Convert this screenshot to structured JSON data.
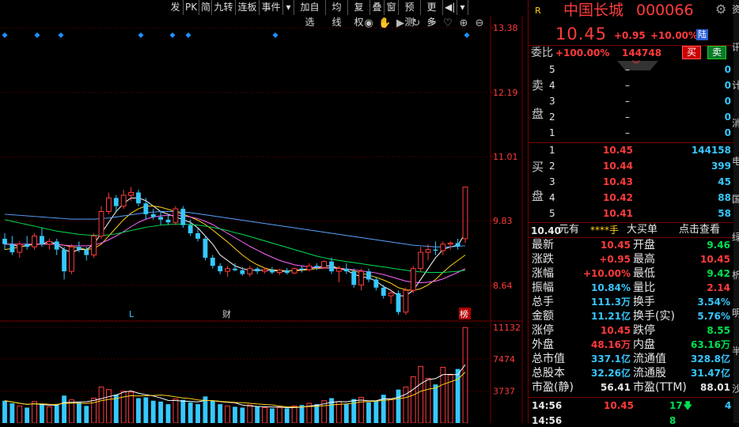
{
  "toolbar": {
    "items": [
      "发",
      "PK",
      "简",
      "九转",
      "连板",
      "事件",
      "▾",
      "加自选",
      "均线",
      "复权",
      "叠",
      "窗",
      "预测",
      "更多",
      "◀|",
      "▾"
    ]
  },
  "iconbar": {
    "icons": [
      "eye-icon",
      "hand-icon",
      "play-icon",
      "refresh-icon",
      "scissors-icon",
      "heart-icon",
      "zoom-in-icon",
      "zoom-out-icon"
    ]
  },
  "main_axis": {
    "ticks": [
      "13.38",
      "12.19",
      "11.01",
      "9.83",
      "8.64"
    ]
  },
  "volume_axis": {
    "ticks": [
      "11132",
      "7474",
      "3737"
    ]
  },
  "markers": {
    "l": "L",
    "cai": "财",
    "bang": "榜"
  },
  "colors": {
    "up": "#ff3b3b",
    "down": "#36c8ff",
    "ma1": "#ffffff",
    "ma2": "#ffd11a",
    "ma3": "#ff66ff",
    "ma4": "#00e050",
    "ma5": "#5aa0ff",
    "grid": "#7a0000",
    "diamond": "#1e90ff"
  },
  "chart_data": {
    "type": "candlestick",
    "ylim": [
      8.0,
      13.6
    ],
    "volume_ylim": [
      0,
      11700
    ],
    "candles": [
      [
        9.5,
        9.6,
        9.3,
        9.4
      ],
      [
        9.4,
        9.55,
        9.2,
        9.25
      ],
      [
        9.25,
        9.45,
        9.15,
        9.4
      ],
      [
        9.4,
        9.55,
        9.3,
        9.35
      ],
      [
        9.35,
        9.6,
        9.3,
        9.55
      ],
      [
        9.55,
        9.7,
        9.35,
        9.4
      ],
      [
        9.4,
        9.5,
        9.3,
        9.45
      ],
      [
        9.45,
        9.5,
        9.2,
        9.3
      ],
      [
        9.3,
        9.35,
        8.75,
        8.9
      ],
      [
        8.9,
        9.4,
        8.85,
        9.35
      ],
      [
        9.35,
        9.45,
        9.25,
        9.3
      ],
      [
        9.3,
        9.35,
        9.1,
        9.2
      ],
      [
        9.2,
        9.6,
        9.15,
        9.55
      ],
      [
        9.55,
        10.1,
        9.5,
        10.0
      ],
      [
        10.0,
        10.35,
        9.95,
        10.25
      ],
      [
        10.25,
        10.3,
        10.0,
        10.1
      ],
      [
        10.1,
        10.4,
        10.05,
        10.3
      ],
      [
        10.3,
        10.45,
        10.2,
        10.35
      ],
      [
        10.35,
        10.4,
        10.1,
        10.15
      ],
      [
        10.15,
        10.25,
        9.85,
        9.95
      ],
      [
        9.95,
        10.05,
        9.85,
        9.9
      ],
      [
        9.9,
        10.0,
        9.75,
        9.85
      ],
      [
        9.85,
        9.95,
        9.75,
        9.8
      ],
      [
        9.8,
        10.1,
        9.75,
        10.05
      ],
      [
        10.05,
        10.1,
        9.7,
        9.75
      ],
      [
        9.75,
        9.85,
        9.55,
        9.6
      ],
      [
        9.6,
        9.7,
        9.45,
        9.5
      ],
      [
        9.5,
        9.55,
        9.1,
        9.15
      ],
      [
        9.15,
        9.2,
        8.95,
        9.0
      ],
      [
        9.0,
        9.05,
        8.85,
        8.9
      ],
      [
        8.9,
        9.0,
        8.8,
        8.95
      ],
      [
        8.95,
        9.05,
        8.9,
        8.92
      ],
      [
        8.92,
        8.98,
        8.82,
        8.85
      ],
      [
        8.85,
        9.0,
        8.8,
        8.95
      ],
      [
        8.95,
        8.98,
        8.85,
        8.9
      ],
      [
        8.9,
        8.97,
        8.86,
        8.93
      ],
      [
        8.93,
        8.98,
        8.85,
        8.88
      ],
      [
        8.88,
        8.95,
        8.83,
        8.92
      ],
      [
        8.92,
        8.96,
        8.84,
        8.87
      ],
      [
        8.87,
        8.97,
        8.85,
        8.95
      ],
      [
        8.95,
        9.0,
        8.88,
        8.93
      ],
      [
        8.93,
        9.05,
        8.9,
        9.0
      ],
      [
        9.0,
        9.05,
        8.92,
        8.97
      ],
      [
        8.97,
        9.1,
        8.95,
        9.08
      ],
      [
        9.08,
        9.15,
        8.85,
        8.9
      ],
      [
        8.9,
        9.0,
        8.7,
        8.95
      ],
      [
        8.95,
        9.05,
        8.85,
        8.9
      ],
      [
        8.9,
        8.95,
        8.6,
        8.65
      ],
      [
        8.65,
        8.95,
        8.55,
        8.9
      ],
      [
        8.9,
        8.95,
        8.7,
        8.75
      ],
      [
        8.75,
        8.8,
        8.55,
        8.6
      ],
      [
        8.6,
        8.65,
        8.4,
        8.45
      ],
      [
        8.45,
        8.55,
        8.3,
        8.5
      ],
      [
        8.5,
        8.55,
        8.1,
        8.15
      ],
      [
        8.15,
        8.6,
        8.1,
        8.55
      ],
      [
        8.55,
        9.0,
        8.5,
        8.95
      ],
      [
        8.95,
        9.35,
        8.9,
        9.25
      ],
      [
        9.25,
        9.4,
        9.1,
        9.3
      ],
      [
        9.3,
        9.45,
        9.2,
        9.28
      ],
      [
        9.28,
        9.45,
        9.2,
        9.4
      ],
      [
        9.4,
        9.45,
        9.3,
        9.42
      ],
      [
        9.42,
        9.5,
        9.3,
        9.36
      ],
      [
        9.5,
        10.45,
        9.42,
        10.45
      ]
    ],
    "volumes": [
      2600,
      2300,
      2000,
      1800,
      2500,
      2200,
      1900,
      2100,
      3200,
      2700,
      2400,
      2000,
      2900,
      4200,
      3900,
      3300,
      3700,
      3600,
      2900,
      3000,
      2600,
      2500,
      2200,
      2800,
      2700,
      2400,
      2200,
      3100,
      2600,
      2200,
      2000,
      1900,
      1800,
      2100,
      1900,
      1800,
      1700,
      1800,
      1700,
      2000,
      2100,
      2300,
      2200,
      2600,
      2900,
      2500,
      2200,
      2800,
      3000,
      2400,
      2600,
      3300,
      2800,
      3900,
      4200,
      5400,
      6600,
      5200,
      4500,
      6500,
      5600,
      6300,
      11132
    ],
    "ma_lines": [
      {
        "values": [
          9.4,
          9.4,
          9.35,
          9.38,
          9.4,
          9.4,
          9.45,
          9.4,
          9.3,
          9.25,
          9.3,
          9.3,
          9.4,
          9.6,
          9.8,
          10.0,
          10.15,
          10.25,
          10.25,
          10.2,
          10.1,
          10.0,
          9.95,
          9.9,
          9.85,
          9.8,
          9.7,
          9.55,
          9.4,
          9.2,
          9.1,
          9.0,
          8.95,
          8.92,
          8.92,
          8.92,
          8.92,
          8.9,
          8.9,
          8.92,
          8.93,
          8.95,
          8.97,
          9.0,
          9.0,
          8.95,
          8.92,
          8.85,
          8.8,
          8.78,
          8.72,
          8.62,
          8.55,
          8.45,
          8.45,
          8.55,
          8.75,
          8.95,
          9.15,
          9.3,
          9.35,
          9.38,
          9.6
        ]
      },
      {
        "values": [
          9.3,
          9.32,
          9.35,
          9.37,
          9.4,
          9.4,
          9.4,
          9.4,
          9.38,
          9.35,
          9.33,
          9.3,
          9.32,
          9.4,
          9.55,
          9.7,
          9.85,
          9.97,
          10.05,
          10.1,
          10.1,
          10.08,
          10.04,
          10.0,
          9.95,
          9.9,
          9.84,
          9.76,
          9.66,
          9.55,
          9.44,
          9.32,
          9.2,
          9.1,
          9.02,
          8.96,
          8.93,
          8.92,
          8.91,
          8.91,
          8.92,
          8.93,
          8.95,
          8.96,
          8.97,
          8.96,
          8.94,
          8.91,
          8.87,
          8.83,
          8.79,
          8.74,
          8.68,
          8.6,
          8.56,
          8.55,
          8.58,
          8.65,
          8.75,
          8.88,
          9.0,
          9.1,
          9.2
        ]
      },
      {
        "values": [
          9.4,
          9.4,
          9.4,
          9.4,
          9.4,
          9.4,
          9.4,
          9.4,
          9.38,
          9.37,
          9.37,
          9.37,
          9.38,
          9.42,
          9.48,
          9.55,
          9.63,
          9.72,
          9.8,
          9.86,
          9.9,
          9.92,
          9.93,
          9.93,
          9.92,
          9.9,
          9.87,
          9.82,
          9.76,
          9.68,
          9.6,
          9.52,
          9.44,
          9.36,
          9.29,
          9.22,
          9.16,
          9.1,
          9.06,
          9.02,
          9.0,
          8.98,
          8.97,
          8.96,
          8.96,
          8.95,
          8.94,
          8.93,
          8.91,
          8.89,
          8.87,
          8.84,
          8.8,
          8.76,
          8.72,
          8.7,
          8.69,
          8.7,
          8.72,
          8.76,
          8.82,
          8.88,
          8.95
        ]
      },
      {
        "values": [
          9.85,
          9.82,
          9.79,
          9.76,
          9.73,
          9.7,
          9.67,
          9.64,
          9.62,
          9.6,
          9.58,
          9.57,
          9.56,
          9.56,
          9.57,
          9.59,
          9.62,
          9.65,
          9.68,
          9.71,
          9.73,
          9.75,
          9.76,
          9.77,
          9.77,
          9.76,
          9.75,
          9.73,
          9.71,
          9.68,
          9.65,
          9.61,
          9.58,
          9.54,
          9.5,
          9.46,
          9.42,
          9.38,
          9.34,
          9.3,
          9.26,
          9.22,
          9.18,
          9.15,
          9.12,
          9.1,
          9.08,
          9.06,
          9.04,
          9.02,
          9.0,
          8.98,
          8.96,
          8.94,
          8.92,
          8.9,
          8.89,
          8.88,
          8.88,
          8.88,
          8.89,
          8.9,
          8.92
        ]
      },
      {
        "values": [
          9.95,
          9.94,
          9.93,
          9.92,
          9.91,
          9.9,
          9.89,
          9.88,
          9.87,
          9.86,
          9.86,
          9.86,
          9.86,
          9.87,
          9.88,
          9.9,
          9.92,
          9.94,
          9.96,
          9.98,
          9.99,
          10.0,
          10.0,
          10.0,
          9.99,
          9.98,
          9.96,
          9.94,
          9.92,
          9.9,
          9.88,
          9.86,
          9.84,
          9.82,
          9.8,
          9.78,
          9.76,
          9.74,
          9.72,
          9.7,
          9.68,
          9.66,
          9.64,
          9.62,
          9.6,
          9.58,
          9.56,
          9.54,
          9.52,
          9.5,
          9.48,
          9.46,
          9.44,
          9.42,
          9.4,
          9.38,
          9.37,
          9.36,
          9.35,
          9.35,
          9.35,
          9.36,
          9.37
        ]
      }
    ]
  },
  "stock": {
    "r_badge": "R",
    "name": "中国长城",
    "code": "000066",
    "price": "10.45",
    "change": "+0.95",
    "pct": "+10.00%",
    "market": "陆"
  },
  "weibi": {
    "label": "委比",
    "pct": "+100.00%",
    "vol": "144748",
    "buy": "买",
    "sell": "卖"
  },
  "sell_side": {
    "label_a": "卖",
    "label_b": "盘",
    "rows": [
      {
        "lvl": "5",
        "price": "–",
        "vol": "0"
      },
      {
        "lvl": "4",
        "price": "–",
        "vol": "0"
      },
      {
        "lvl": "3",
        "price": "–",
        "vol": "0"
      },
      {
        "lvl": "2",
        "price": "–",
        "vol": "0"
      },
      {
        "lvl": "1",
        "price": "–",
        "vol": "0"
      }
    ]
  },
  "buy_side": {
    "label_a": "买",
    "label_b": "盘",
    "rows": [
      {
        "lvl": "1",
        "price": "10.45",
        "vol": "144158"
      },
      {
        "lvl": "2",
        "price": "10.44",
        "vol": "399"
      },
      {
        "lvl": "3",
        "price": "10.43",
        "vol": "45"
      },
      {
        "lvl": "4",
        "price": "10.42",
        "vol": "88"
      },
      {
        "lvl": "5",
        "price": "10.41",
        "vol": "58"
      }
    ]
  },
  "info_bar": {
    "price": "10.40",
    "unit": "元有",
    "stars": "****手",
    "big": "大买单",
    "hint": "点击查看"
  },
  "stats": [
    {
      "l1": "最新",
      "v1": "10.45",
      "c1": "red",
      "l2": "开盘",
      "v2": "9.46",
      "c2": "green"
    },
    {
      "l1": "涨跌",
      "v1": "+0.95",
      "c1": "red",
      "l2": "最高",
      "v2": "10.45",
      "c2": "red"
    },
    {
      "l1": "涨幅",
      "v1": "+10.00%",
      "c1": "red",
      "l2": "最低",
      "v2": "9.42",
      "c2": "green"
    },
    {
      "l1": "振幅",
      "v1": "10.84%",
      "c1": "cyan",
      "l2": "量比",
      "v2": "2.14",
      "c2": "red"
    },
    {
      "l1": "总手",
      "v1": "111.3万",
      "c1": "cyan",
      "l2": "换手",
      "v2": "3.54%",
      "c2": "cyan"
    },
    {
      "l1": "金额",
      "v1": "11.21亿",
      "c1": "cyan",
      "l2": "换手(实)",
      "v2": "5.76%",
      "c2": "cyan"
    },
    {
      "l1": "涨停",
      "v1": "10.45",
      "c1": "red",
      "l2": "跌停",
      "v2": "8.55",
      "c2": "green"
    },
    {
      "l1": "外盘",
      "v1": "48.16万",
      "c1": "red",
      "l2": "内盘",
      "v2": "63.16万",
      "c2": "green"
    },
    {
      "l1": "总市值",
      "v1": "337.1亿",
      "c1": "cyan",
      "l2": "流通值",
      "v2": "328.8亿",
      "c2": "cyan"
    },
    {
      "l1": "总股本",
      "v1": "32.26亿",
      "c1": "cyan",
      "l2": "流通股",
      "v2": "31.47亿",
      "c2": "cyan"
    },
    {
      "l1": "市盈(静)",
      "v1": "56.41",
      "c1": "white",
      "l2": "市盈(TTM)",
      "v2": "88.01",
      "c2": "white"
    }
  ],
  "trade": {
    "time": "14:56",
    "price": "10.45",
    "vol": "17",
    "extra": "4"
  },
  "trade2": {
    "time": "14:56",
    "vol": "8"
  },
  "edge_chars": [
    "资",
    "讯",
    "计",
    "消",
    "电",
    "国",
    "绿",
    "析",
    "明",
    "半",
    "沙"
  ]
}
